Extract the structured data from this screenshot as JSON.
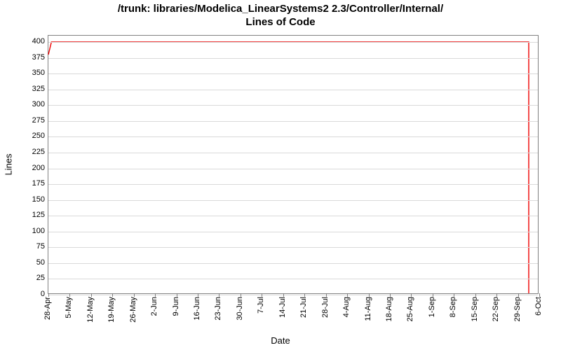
{
  "chart_data": {
    "type": "line",
    "title_line1": "/trunk: libraries/Modelica_LinearSystems2 2.3/Controller/Internal/",
    "title_line2": "Lines of Code",
    "xlabel": "Date",
    "ylabel": "Lines",
    "ylim": [
      0,
      410
    ],
    "yticks": [
      0,
      25,
      50,
      75,
      100,
      125,
      150,
      175,
      200,
      225,
      250,
      275,
      300,
      325,
      350,
      375,
      400
    ],
    "x_categories": [
      "28-Apr",
      "5-May",
      "12-May",
      "19-May",
      "26-May",
      "2-Jun",
      "9-Jun",
      "16-Jun",
      "23-Jun",
      "30-Jun",
      "7-Jul",
      "14-Jul",
      "21-Jul",
      "28-Jul",
      "4-Aug",
      "11-Aug",
      "18-Aug",
      "25-Aug",
      "1-Sep",
      "8-Sep",
      "15-Sep",
      "22-Sep",
      "29-Sep",
      "6-Oct"
    ],
    "series": [
      {
        "name": "Lines of Code",
        "color": "#ee0000",
        "points": [
          {
            "x": "28-Apr",
            "y": 380
          },
          {
            "x": "29-Apr",
            "y": 400
          },
          {
            "x": "3-Oct",
            "y": 400
          },
          {
            "x": "3-Oct",
            "y": 0
          }
        ]
      }
    ]
  }
}
